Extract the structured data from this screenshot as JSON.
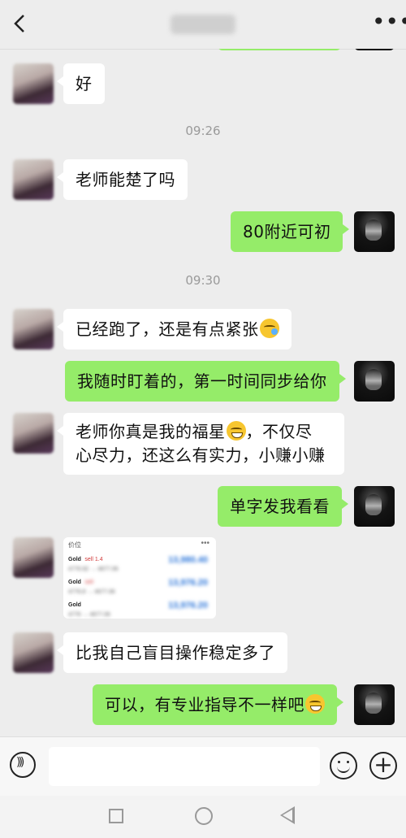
{
  "header": {
    "title": "老张",
    "more_label": "•••"
  },
  "messages": [
    {
      "side": "left",
      "text": "好"
    },
    {
      "type": "time",
      "text": "09:26"
    },
    {
      "side": "left",
      "text": "老师能楚了吗"
    },
    {
      "side": "right",
      "text": "80附近可初"
    },
    {
      "type": "time",
      "text": "09:30"
    },
    {
      "side": "left",
      "text": "已经跑了，还是有点紧张",
      "emoji": "crying-laughing"
    },
    {
      "side": "right",
      "text": "我随时盯着的，第一时间同步给你"
    },
    {
      "side": "left",
      "text_line1": "老师你真是我的福星",
      "emoji": "grinning",
      "text_line1_tail": "，不仅尽",
      "text_line2": "心尽力，还这么有实力，小赚小赚"
    },
    {
      "side": "right",
      "text": "单字发我看看"
    },
    {
      "side": "left",
      "type": "image",
      "card": {
        "header": "价位",
        "rows": [
          {
            "name": "Gold",
            "tag": "sell 1.4",
            "prices": "4776.92 → 4677.06",
            "value": "13,980.40"
          },
          {
            "name": "Gold",
            "tag": "sell",
            "prices": "4776.8 → 4677.06",
            "value": "13,976.20"
          },
          {
            "name": "Gold",
            "tag": "",
            "prices": "4776 → 4677.06",
            "value": "13,976.20"
          }
        ]
      }
    },
    {
      "side": "left",
      "text": "比我自己盲目操作稳定多了"
    },
    {
      "side": "right",
      "text": "可以，有专业指导不一样吧",
      "emoji": "smirk"
    }
  ],
  "input": {
    "placeholder": ""
  }
}
